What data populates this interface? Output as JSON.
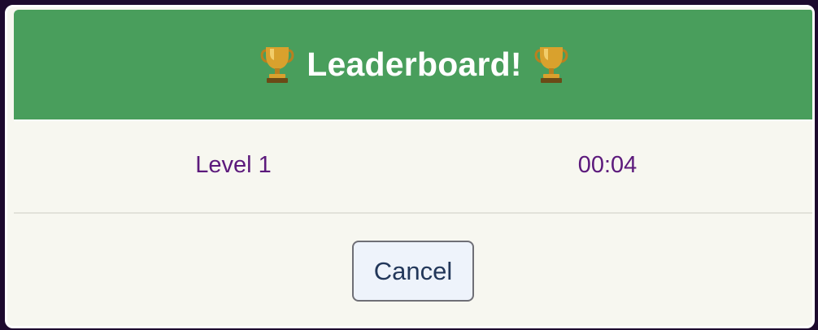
{
  "modal": {
    "title": "Leaderboard!",
    "icon_left": "trophy-icon",
    "icon_right": "trophy-icon",
    "colors": {
      "header_bg": "#499e5c",
      "body_bg": "#f7f7f0",
      "text_accent": "#5c1a7c",
      "backdrop": "#1d0a2e"
    }
  },
  "leaderboard": {
    "entries": [
      {
        "level": "Level 1",
        "time": "00:04"
      }
    ]
  },
  "footer": {
    "cancel_label": "Cancel"
  }
}
